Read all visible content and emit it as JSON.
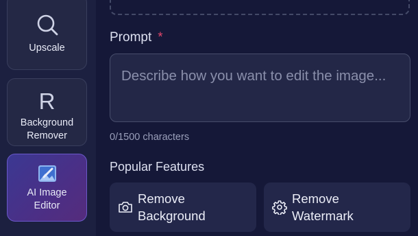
{
  "sidebar": {
    "tools": [
      {
        "label": "Upscale",
        "icon": "search-icon"
      },
      {
        "label": "Background Remover",
        "icon_glyph": "R",
        "icon": "r-letter-icon"
      },
      {
        "label": "AI Image Editor",
        "icon": "image-edit-icon",
        "active": true
      }
    ]
  },
  "prompt": {
    "label": "Prompt",
    "required_mark": "*",
    "placeholder": "Describe how you want to edit the image...",
    "counter": "0/1500 characters"
  },
  "features": {
    "title": "Popular Features",
    "items": [
      {
        "label": "Remove Background",
        "icon": "camera-icon"
      },
      {
        "label": "Remove Watermark",
        "icon": "gear-icon"
      }
    ]
  },
  "colors": {
    "background": "#151838",
    "sidebar": "#1c2040",
    "active_tool": "#4b2f86",
    "required": "#e0466a"
  }
}
